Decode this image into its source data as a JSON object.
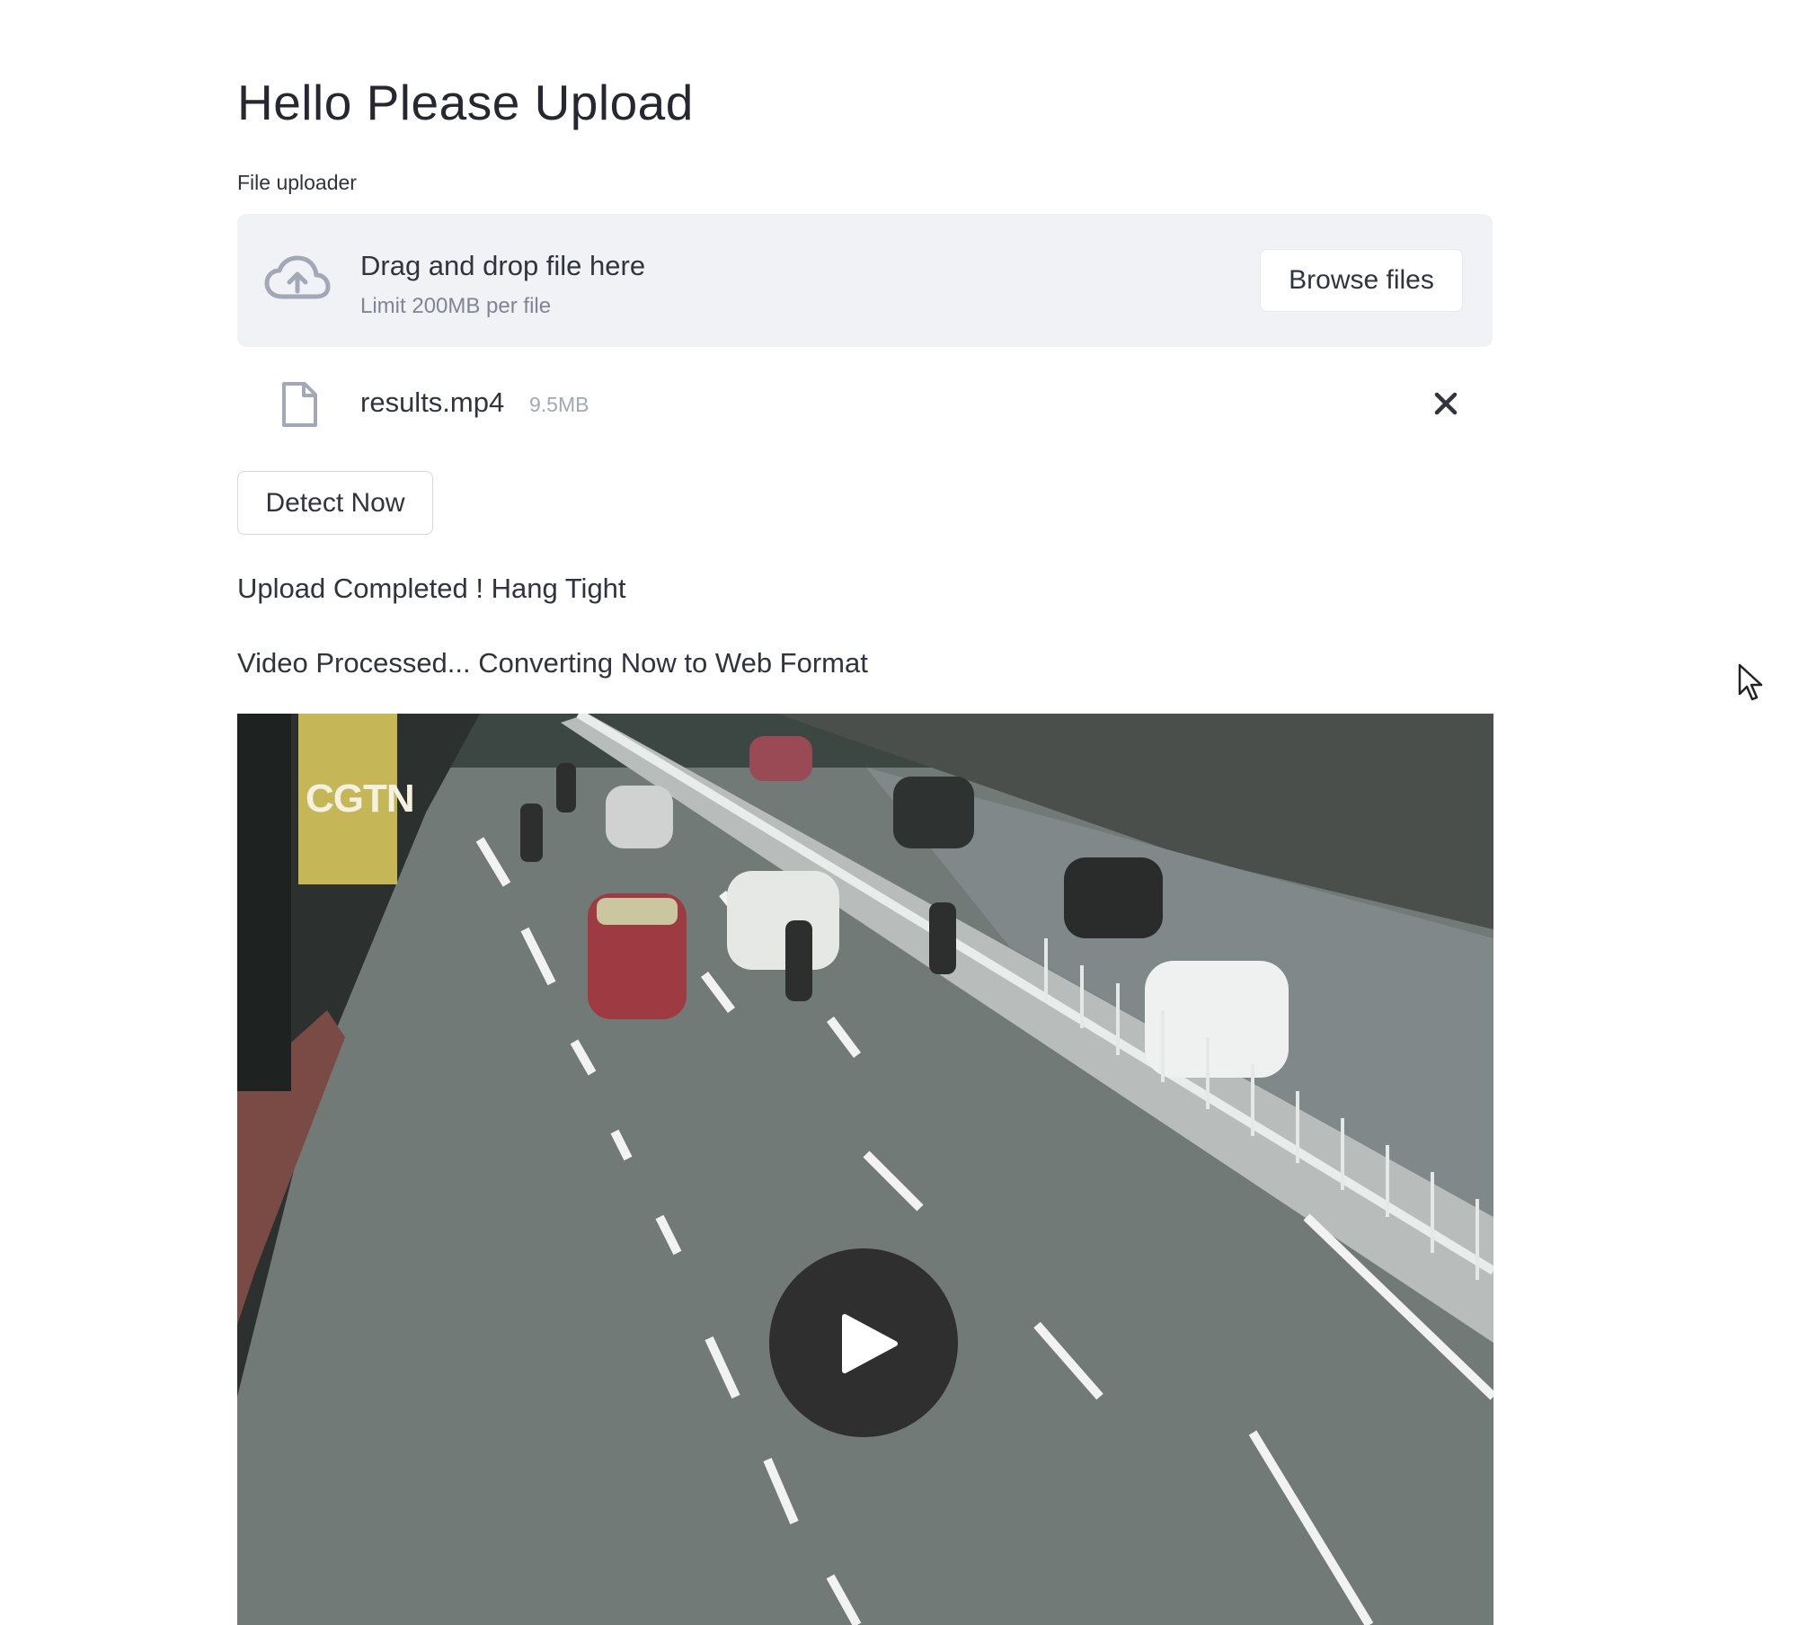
{
  "page": {
    "title": "Hello Please Upload"
  },
  "uploader": {
    "label": "File uploader",
    "drop_text": "Drag and drop file here",
    "limit_text": "Limit 200MB per file",
    "browse_label": "Browse files",
    "icon": "cloud-upload-icon"
  },
  "file": {
    "name": "results.mp4",
    "size": "9.5MB",
    "icon": "file-icon",
    "remove_icon": "close-icon"
  },
  "actions": {
    "detect_label": "Detect Now"
  },
  "status": {
    "upload": "Upload Completed ! Hang Tight",
    "processing": "Video Processed... Converting Now to Web Format"
  },
  "video": {
    "watermark": "CGTN",
    "play_icon": "play-icon"
  },
  "colors": {
    "dropzone_bg": "#f0f2f6",
    "text": "#31333f",
    "muted": "#808495"
  }
}
